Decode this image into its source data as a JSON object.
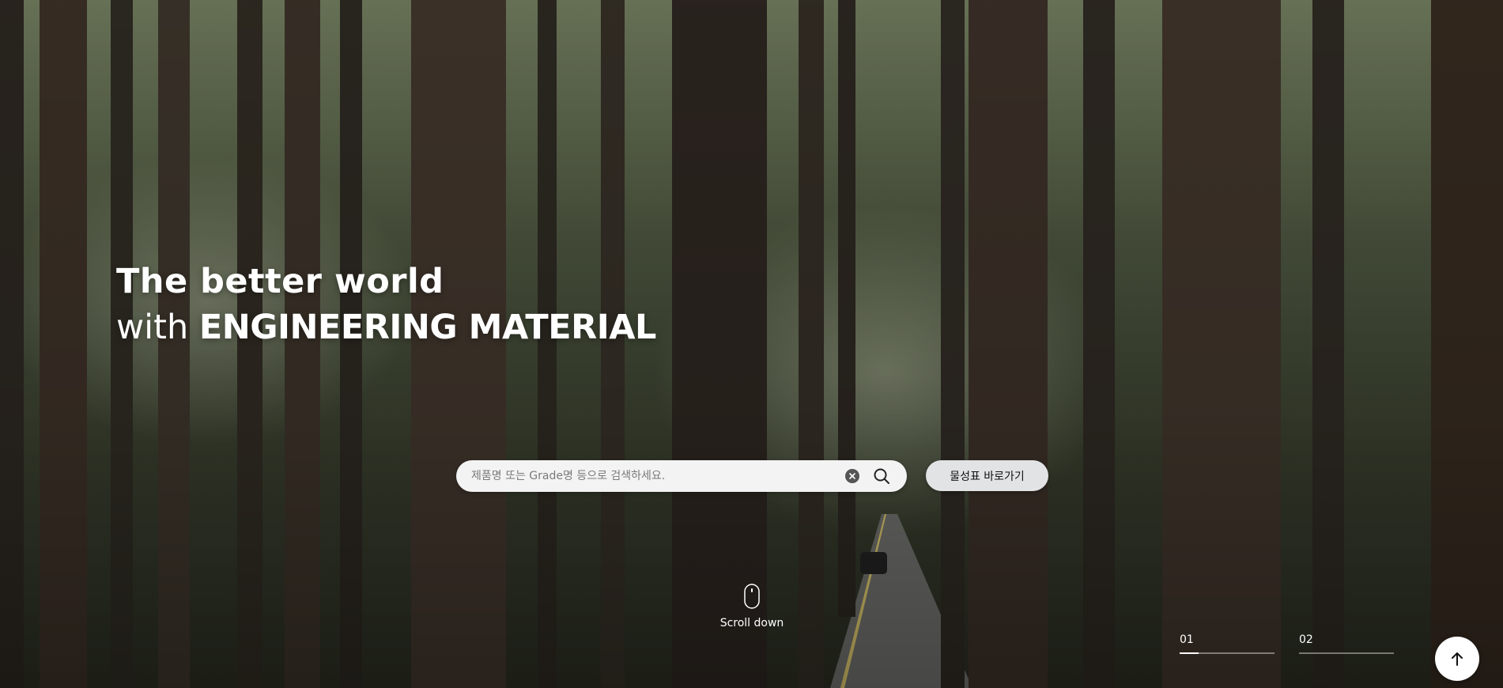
{
  "hero": {
    "headline_line1": "The better world",
    "headline_line2_prefix": "with ",
    "headline_line2_strong": "ENGINEERING MATERIAL"
  },
  "search": {
    "placeholder": "제품명 또는 Grade명 등으로 검색하세요.",
    "value": "",
    "clear_icon": "close-circle-icon",
    "search_icon": "magnifier-icon"
  },
  "properties_button": {
    "label": "물성표 바로가기"
  },
  "scroll": {
    "label": "Scroll down",
    "icon": "mouse-icon"
  },
  "pager": {
    "items": [
      {
        "label": "01",
        "progress": 0.2
      },
      {
        "label": "02",
        "progress": 0
      }
    ]
  },
  "back_to_top": {
    "icon": "arrow-up-icon"
  },
  "colors": {
    "text": "#ffffff",
    "search_bg": "#f3f3f3",
    "button_bg": "#e2e3e5",
    "forest_dark": "#2a2d22"
  }
}
